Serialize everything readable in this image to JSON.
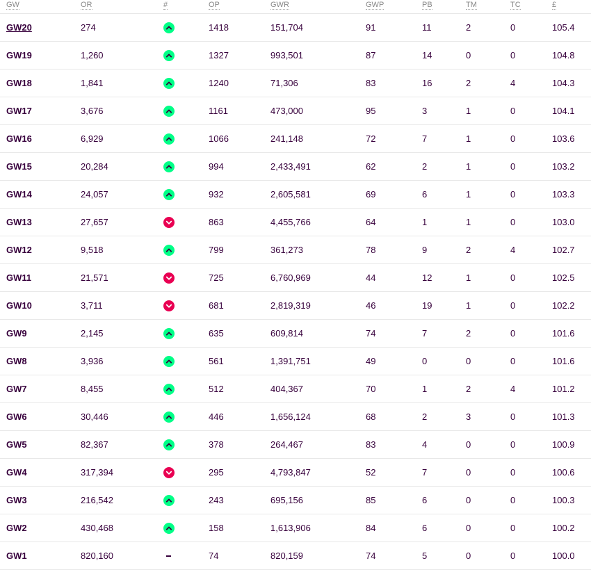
{
  "headers": {
    "gw": "GW",
    "or": "OR",
    "movement": "#",
    "op": "OP",
    "gwr": "GWR",
    "gwp": "GWP",
    "pb": "PB",
    "tm": "TM",
    "tc": "TC",
    "value": "£"
  },
  "rows": [
    {
      "gw": "GW20",
      "or": "274",
      "move": "up",
      "op": "1418",
      "gwr": "151,704",
      "gwp": "91",
      "pb": "11",
      "tm": "2",
      "tc": "0",
      "value": "105.4"
    },
    {
      "gw": "GW19",
      "or": "1,260",
      "move": "up",
      "op": "1327",
      "gwr": "993,501",
      "gwp": "87",
      "pb": "14",
      "tm": "0",
      "tc": "0",
      "value": "104.8"
    },
    {
      "gw": "GW18",
      "or": "1,841",
      "move": "up",
      "op": "1240",
      "gwr": "71,306",
      "gwp": "83",
      "pb": "16",
      "tm": "2",
      "tc": "4",
      "value": "104.3"
    },
    {
      "gw": "GW17",
      "or": "3,676",
      "move": "up",
      "op": "1161",
      "gwr": "473,000",
      "gwp": "95",
      "pb": "3",
      "tm": "1",
      "tc": "0",
      "value": "104.1"
    },
    {
      "gw": "GW16",
      "or": "6,929",
      "move": "up",
      "op": "1066",
      "gwr": "241,148",
      "gwp": "72",
      "pb": "7",
      "tm": "1",
      "tc": "0",
      "value": "103.6"
    },
    {
      "gw": "GW15",
      "or": "20,284",
      "move": "up",
      "op": "994",
      "gwr": "2,433,491",
      "gwp": "62",
      "pb": "2",
      "tm": "1",
      "tc": "0",
      "value": "103.2"
    },
    {
      "gw": "GW14",
      "or": "24,057",
      "move": "up",
      "op": "932",
      "gwr": "2,605,581",
      "gwp": "69",
      "pb": "6",
      "tm": "1",
      "tc": "0",
      "value": "103.3"
    },
    {
      "gw": "GW13",
      "or": "27,657",
      "move": "down",
      "op": "863",
      "gwr": "4,455,766",
      "gwp": "64",
      "pb": "1",
      "tm": "1",
      "tc": "0",
      "value": "103.0"
    },
    {
      "gw": "GW12",
      "or": "9,518",
      "move": "up",
      "op": "799",
      "gwr": "361,273",
      "gwp": "78",
      "pb": "9",
      "tm": "2",
      "tc": "4",
      "value": "102.7"
    },
    {
      "gw": "GW11",
      "or": "21,571",
      "move": "down",
      "op": "725",
      "gwr": "6,760,969",
      "gwp": "44",
      "pb": "12",
      "tm": "1",
      "tc": "0",
      "value": "102.5"
    },
    {
      "gw": "GW10",
      "or": "3,711",
      "move": "down",
      "op": "681",
      "gwr": "2,819,319",
      "gwp": "46",
      "pb": "19",
      "tm": "1",
      "tc": "0",
      "value": "102.2"
    },
    {
      "gw": "GW9",
      "or": "2,145",
      "move": "up",
      "op": "635",
      "gwr": "609,814",
      "gwp": "74",
      "pb": "7",
      "tm": "2",
      "tc": "0",
      "value": "101.6"
    },
    {
      "gw": "GW8",
      "or": "3,936",
      "move": "up",
      "op": "561",
      "gwr": "1,391,751",
      "gwp": "49",
      "pb": "0",
      "tm": "0",
      "tc": "0",
      "value": "101.6"
    },
    {
      "gw": "GW7",
      "or": "8,455",
      "move": "up",
      "op": "512",
      "gwr": "404,367",
      "gwp": "70",
      "pb": "1",
      "tm": "2",
      "tc": "4",
      "value": "101.2"
    },
    {
      "gw": "GW6",
      "or": "30,446",
      "move": "up",
      "op": "446",
      "gwr": "1,656,124",
      "gwp": "68",
      "pb": "2",
      "tm": "3",
      "tc": "0",
      "value": "101.3"
    },
    {
      "gw": "GW5",
      "or": "82,367",
      "move": "up",
      "op": "378",
      "gwr": "264,467",
      "gwp": "83",
      "pb": "4",
      "tm": "0",
      "tc": "0",
      "value": "100.9"
    },
    {
      "gw": "GW4",
      "or": "317,394",
      "move": "down",
      "op": "295",
      "gwr": "4,793,847",
      "gwp": "52",
      "pb": "7",
      "tm": "0",
      "tc": "0",
      "value": "100.6"
    },
    {
      "gw": "GW3",
      "or": "216,542",
      "move": "up",
      "op": "243",
      "gwr": "695,156",
      "gwp": "85",
      "pb": "6",
      "tm": "0",
      "tc": "0",
      "value": "100.3"
    },
    {
      "gw": "GW2",
      "or": "430,468",
      "move": "up",
      "op": "158",
      "gwr": "1,613,906",
      "gwp": "84",
      "pb": "6",
      "tm": "0",
      "tc": "0",
      "value": "100.2"
    },
    {
      "gw": "GW1",
      "or": "820,160",
      "move": "same",
      "op": "74",
      "gwr": "820,159",
      "gwp": "74",
      "pb": "5",
      "tm": "0",
      "tc": "0",
      "value": "100.0"
    }
  ],
  "colors": {
    "text": "#37003c",
    "up": "#00ff87",
    "down": "#e90052",
    "header": "#888888"
  },
  "icons": {
    "up": "chevron-up-icon",
    "down": "chevron-down-icon",
    "same": "dash-icon"
  }
}
